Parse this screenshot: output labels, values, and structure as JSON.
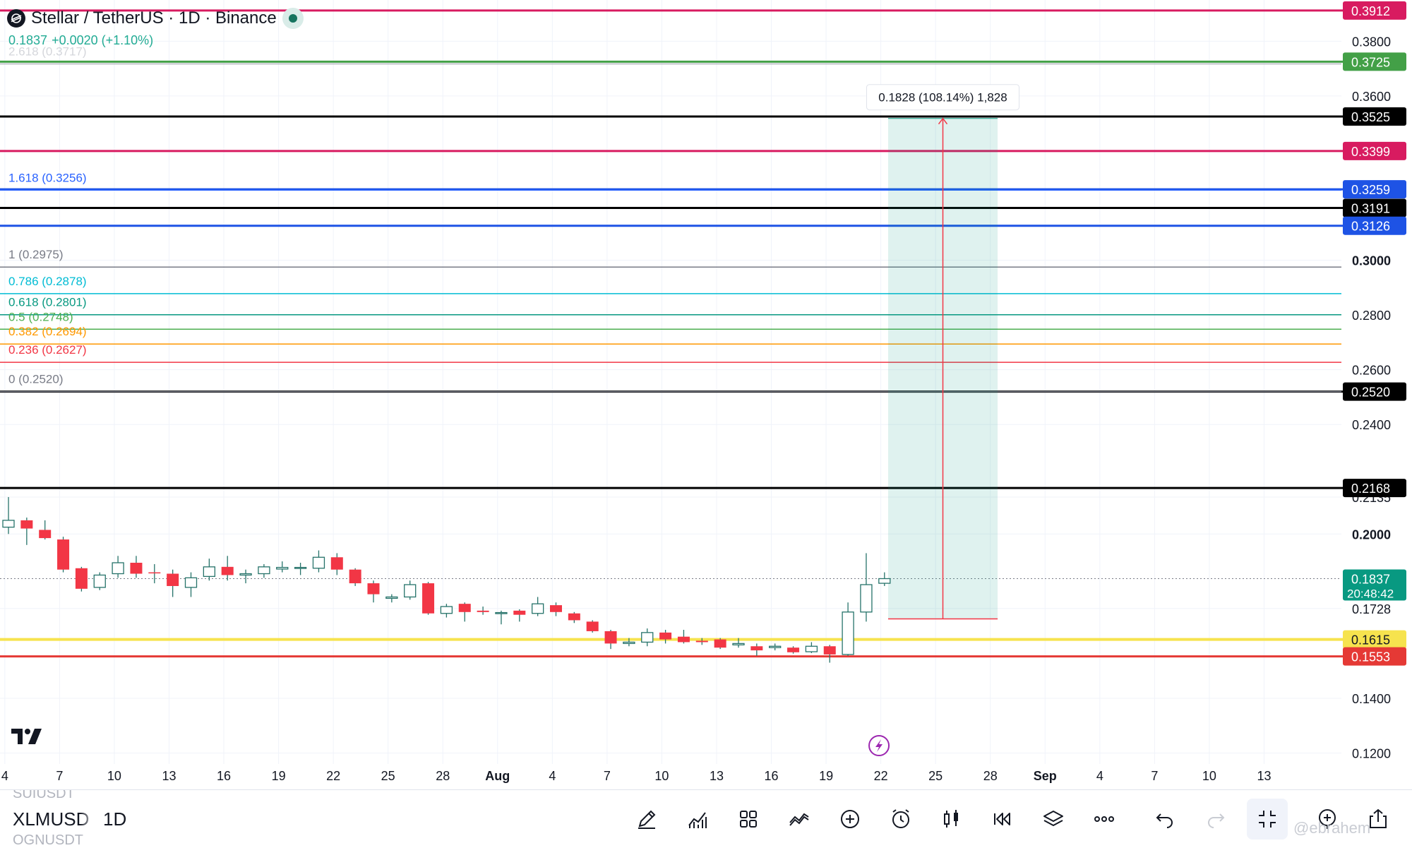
{
  "header": {
    "title": "Stellar / TetherUS · 1D · Binance",
    "last_price": "0.1837",
    "change": "+0.0020 (+1.10%)",
    "symbol_icon": "stellar-logo-icon",
    "live_indicator_icon": "market-open-dot-icon"
  },
  "chart_data": {
    "type": "candlestick",
    "symbol": "XLMUSD",
    "interval": "1D",
    "ylim": [
      0.116,
      0.3935
    ],
    "x_ticks": [
      "4",
      "7",
      "10",
      "13",
      "16",
      "19",
      "22",
      "25",
      "28",
      "Aug",
      "4",
      "7",
      "10",
      "13",
      "16",
      "19",
      "22",
      "25",
      "28",
      "Sep",
      "4",
      "7",
      "10",
      "13"
    ],
    "y_ticks": [
      "0.1200",
      "0.1400",
      "0.1728",
      "0.2000",
      "0.2135",
      "0.2400",
      "0.2600",
      "0.2800",
      "0.3000",
      "0.3600",
      "0.3800"
    ],
    "candles": [
      {
        "o": 0.2025,
        "h": 0.2135,
        "l": 0.2,
        "c": 0.205
      },
      {
        "o": 0.205,
        "h": 0.206,
        "l": 0.196,
        "c": 0.202
      },
      {
        "o": 0.2015,
        "h": 0.205,
        "l": 0.198,
        "c": 0.1985
      },
      {
        "o": 0.198,
        "h": 0.199,
        "l": 0.186,
        "c": 0.187
      },
      {
        "o": 0.1875,
        "h": 0.188,
        "l": 0.179,
        "c": 0.18
      },
      {
        "o": 0.1805,
        "h": 0.186,
        "l": 0.1795,
        "c": 0.185
      },
      {
        "o": 0.1855,
        "h": 0.192,
        "l": 0.184,
        "c": 0.1895
      },
      {
        "o": 0.1895,
        "h": 0.192,
        "l": 0.184,
        "c": 0.1855
      },
      {
        "o": 0.186,
        "h": 0.189,
        "l": 0.182,
        "c": 0.1858
      },
      {
        "o": 0.1855,
        "h": 0.187,
        "l": 0.177,
        "c": 0.181
      },
      {
        "o": 0.1805,
        "h": 0.186,
        "l": 0.177,
        "c": 0.184
      },
      {
        "o": 0.1845,
        "h": 0.191,
        "l": 0.183,
        "c": 0.188
      },
      {
        "o": 0.188,
        "h": 0.192,
        "l": 0.183,
        "c": 0.185
      },
      {
        "o": 0.185,
        "h": 0.187,
        "l": 0.182,
        "c": 0.1855
      },
      {
        "o": 0.1855,
        "h": 0.189,
        "l": 0.184,
        "c": 0.188
      },
      {
        "o": 0.1872,
        "h": 0.19,
        "l": 0.186,
        "c": 0.1878
      },
      {
        "o": 0.1875,
        "h": 0.1895,
        "l": 0.185,
        "c": 0.1878
      },
      {
        "o": 0.1875,
        "h": 0.194,
        "l": 0.186,
        "c": 0.1915
      },
      {
        "o": 0.1915,
        "h": 0.193,
        "l": 0.185,
        "c": 0.187
      },
      {
        "o": 0.187,
        "h": 0.1875,
        "l": 0.181,
        "c": 0.182
      },
      {
        "o": 0.182,
        "h": 0.183,
        "l": 0.175,
        "c": 0.178
      },
      {
        "o": 0.1765,
        "h": 0.178,
        "l": 0.175,
        "c": 0.177
      },
      {
        "o": 0.177,
        "h": 0.183,
        "l": 0.176,
        "c": 0.1815
      },
      {
        "o": 0.182,
        "h": 0.1825,
        "l": 0.1705,
        "c": 0.171
      },
      {
        "o": 0.171,
        "h": 0.1745,
        "l": 0.1695,
        "c": 0.1735
      },
      {
        "o": 0.1745,
        "h": 0.175,
        "l": 0.168,
        "c": 0.1715
      },
      {
        "o": 0.172,
        "h": 0.1735,
        "l": 0.1705,
        "c": 0.1715
      },
      {
        "o": 0.171,
        "h": 0.172,
        "l": 0.167,
        "c": 0.1713
      },
      {
        "o": 0.172,
        "h": 0.1725,
        "l": 0.168,
        "c": 0.1705
      },
      {
        "o": 0.171,
        "h": 0.177,
        "l": 0.17,
        "c": 0.1745
      },
      {
        "o": 0.174,
        "h": 0.175,
        "l": 0.17,
        "c": 0.1715
      },
      {
        "o": 0.171,
        "h": 0.1715,
        "l": 0.1675,
        "c": 0.1685
      },
      {
        "o": 0.168,
        "h": 0.1685,
        "l": 0.164,
        "c": 0.1645
      },
      {
        "o": 0.1645,
        "h": 0.165,
        "l": 0.158,
        "c": 0.16
      },
      {
        "o": 0.16,
        "h": 0.162,
        "l": 0.159,
        "c": 0.1605
      },
      {
        "o": 0.1605,
        "h": 0.1655,
        "l": 0.159,
        "c": 0.164
      },
      {
        "o": 0.164,
        "h": 0.165,
        "l": 0.16,
        "c": 0.1615
      },
      {
        "o": 0.1625,
        "h": 0.165,
        "l": 0.16,
        "c": 0.1605
      },
      {
        "o": 0.161,
        "h": 0.162,
        "l": 0.1595,
        "c": 0.1605
      },
      {
        "o": 0.1615,
        "h": 0.162,
        "l": 0.158,
        "c": 0.1585
      },
      {
        "o": 0.1595,
        "h": 0.162,
        "l": 0.1585,
        "c": 0.16
      },
      {
        "o": 0.159,
        "h": 0.16,
        "l": 0.1555,
        "c": 0.1575
      },
      {
        "o": 0.1585,
        "h": 0.16,
        "l": 0.1575,
        "c": 0.159
      },
      {
        "o": 0.1585,
        "h": 0.159,
        "l": 0.1563,
        "c": 0.1568
      },
      {
        "o": 0.157,
        "h": 0.1605,
        "l": 0.1565,
        "c": 0.159
      },
      {
        "o": 0.159,
        "h": 0.1595,
        "l": 0.153,
        "c": 0.156
      },
      {
        "o": 0.156,
        "h": 0.175,
        "l": 0.1555,
        "c": 0.1715
      },
      {
        "o": 0.1715,
        "h": 0.193,
        "l": 0.168,
        "c": 0.1815
      },
      {
        "o": 0.182,
        "h": 0.186,
        "l": 0.181,
        "c": 0.1837
      }
    ],
    "horizontal_lines": [
      {
        "value": 0.3912,
        "color": "#d81b60",
        "label": "0.3912",
        "width": 3
      },
      {
        "value": 0.3725,
        "color": "#43a047",
        "label": "0.3725",
        "width": 3
      },
      {
        "value": 0.3525,
        "color": "#000000",
        "label": "0.3525",
        "width": 3
      },
      {
        "value": 0.3399,
        "color": "#d81b60",
        "label": "0.3399",
        "width": 3
      },
      {
        "value": 0.3259,
        "color": "#1e53e5",
        "label": "0.3259",
        "width": 3
      },
      {
        "value": 0.3191,
        "color": "#000000",
        "label": "0.3191",
        "width": 3
      },
      {
        "value": 0.3126,
        "color": "#1e53e5",
        "label": "0.3126",
        "width": 3
      },
      {
        "value": 0.252,
        "color": "#000000",
        "label": "0.2520",
        "width": 3
      },
      {
        "value": 0.2168,
        "color": "#000000",
        "label": "0.2168",
        "width": 3
      },
      {
        "value": 0.1615,
        "color": "#f6e34e",
        "label": "0.1615",
        "width": 4,
        "text_color": "#131722"
      },
      {
        "value": 0.1553,
        "color": "#e53935",
        "label": "0.1553",
        "width": 3
      }
    ],
    "fib_levels": [
      {
        "label": "2.618 (0.3717)",
        "value": 0.3717,
        "color": "#b2b5be",
        "show_label": true
      },
      {
        "label": "1.618 (0.3256)",
        "value": 0.3256,
        "color": "#2962ff",
        "show_label": true
      },
      {
        "label": "1 (0.2975)",
        "value": 0.2975,
        "color": "#787b86",
        "show_label": true
      },
      {
        "label": "0.786 (0.2878)",
        "value": 0.2878,
        "color": "#00bcd4",
        "show_label": true
      },
      {
        "label": "0.618 (0.2801)",
        "value": 0.2801,
        "color": "#089981",
        "show_label": true
      },
      {
        "label": "0.5 (0.2748)",
        "value": 0.2748,
        "color": "#4caf50",
        "show_label": true
      },
      {
        "label": "0.382 (0.2694)",
        "value": 0.2694,
        "color": "#ff9800",
        "show_label": true
      },
      {
        "label": "0.236 (0.2627)",
        "value": 0.2627,
        "color": "#f23645",
        "show_label": true
      },
      {
        "label": "0 (0.2520)",
        "value": 0.252,
        "color": "#787b86",
        "show_label": true
      }
    ],
    "measure": {
      "from": 0.169,
      "to": 0.3518,
      "start_index": 48.2,
      "end_index": 54.2,
      "label": "0.1828 (108.14%) 1,828"
    },
    "current_price_label": {
      "price": "0.1837",
      "countdown": "20:48:42",
      "value": 0.1837,
      "color": "#089981"
    },
    "event_icon": "lightning-icon"
  },
  "bottom_bar": {
    "symbol": "XLMUSD",
    "symbol_above": "SUIUSDT",
    "symbol_below": "OGNUSDT",
    "interval": "1D",
    "tools": [
      {
        "name": "draw-icon"
      },
      {
        "name": "indicators-icon"
      },
      {
        "name": "layouts-icon"
      },
      {
        "name": "compare-icon"
      },
      {
        "name": "add-icon"
      },
      {
        "name": "alert-icon"
      },
      {
        "name": "chart-type-icon"
      },
      {
        "name": "replay-icon"
      },
      {
        "name": "layers-icon"
      },
      {
        "name": "more-icon"
      },
      {
        "name": "undo-icon"
      },
      {
        "name": "redo-icon"
      },
      {
        "name": "fullscreen-exit-icon"
      },
      {
        "name": "zoom-in-icon"
      },
      {
        "name": "share-icon"
      }
    ],
    "watermark": "@ebrahem"
  }
}
